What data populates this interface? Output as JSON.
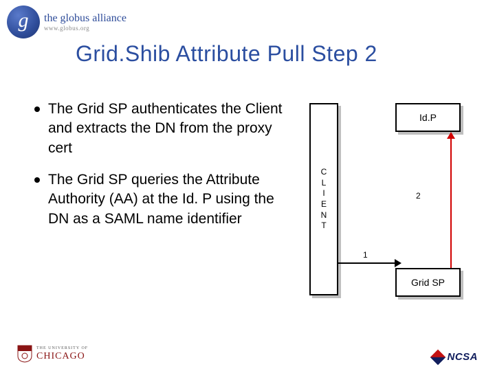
{
  "header": {
    "logo_letter": "g",
    "logo_row1": "the globus alliance",
    "logo_row2": "www.globus.org"
  },
  "title": "Grid.Shib Attribute Pull Step 2",
  "bullets": [
    "The Grid SP authenticates the Client and extracts the DN from the proxy cert",
    "The Grid SP queries the Attribute Authority (AA) at the Id. P using the DN as a SAML name identifier"
  ],
  "diagram": {
    "client_label": "C\nL\nI\nE\nN\nT",
    "idp_label": "Id.P",
    "gridsp_label": "Grid SP",
    "arrow1_label": "1",
    "arrow2_label": "2"
  },
  "footer": {
    "chicago_line1": "THE UNIVERSITY OF",
    "chicago_line2": "CHICAGO",
    "ncsa": "NCSA"
  }
}
